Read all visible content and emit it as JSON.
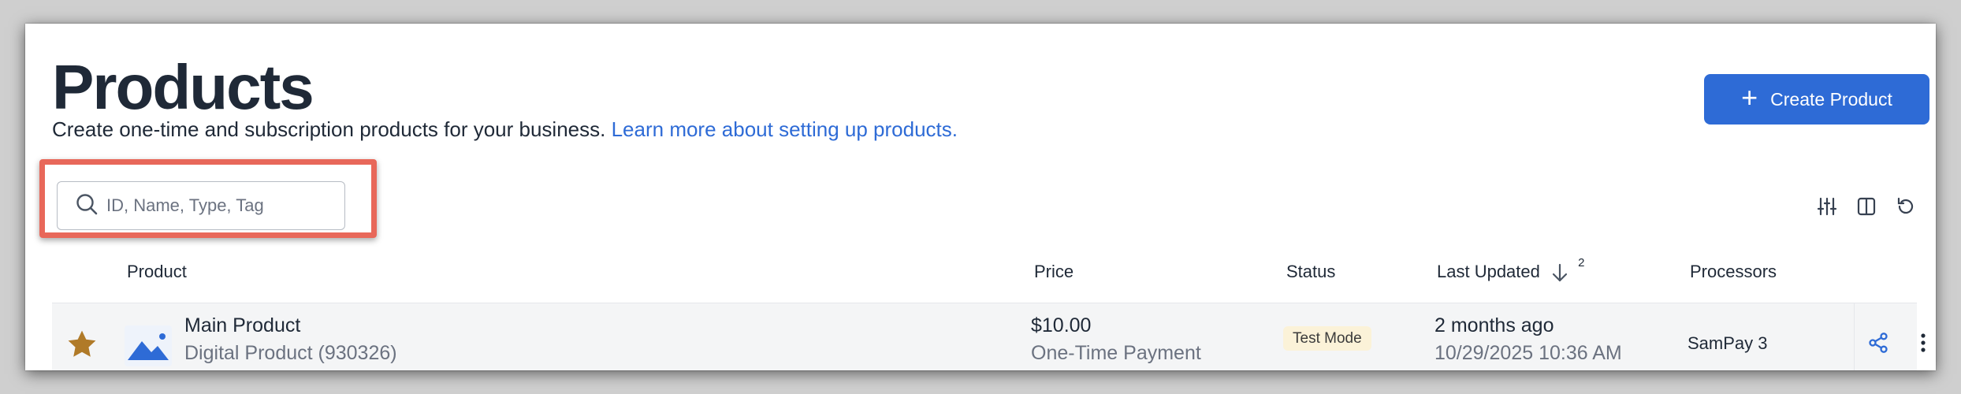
{
  "page": {
    "title": "Products",
    "subtitle": "Create one-time and subscription products for your business.",
    "learn_more_link": "Learn more about setting up products."
  },
  "create_button": {
    "label": "Create Product",
    "icon": "plus-icon"
  },
  "search": {
    "placeholder": "ID, Name, Type, Tag",
    "value": "",
    "icon": "search-icon"
  },
  "toolbar_icons": [
    "filter-sliders-icon",
    "columns-icon",
    "refresh-icon"
  ],
  "table": {
    "columns": {
      "product": "Product",
      "price": "Price",
      "status": "Status",
      "last_updated": "Last Updated",
      "last_updated_sort_index": "2",
      "processors": "Processors"
    },
    "rows": [
      {
        "starred": true,
        "name": "Main Product",
        "type_id": "Digital Product  (930326)",
        "price": "$10.00",
        "price_type": "One-Time Payment",
        "status": "Test Mode",
        "updated_relative": "2 months ago",
        "updated_absolute": "10/29/2025 10:36 AM",
        "processor": "SamPay 3"
      }
    ]
  },
  "colors": {
    "accent": "#2e6bd6",
    "highlight_border": "#e8685a",
    "star": "#b07a28",
    "status_badge_bg": "#fbf2d8"
  }
}
